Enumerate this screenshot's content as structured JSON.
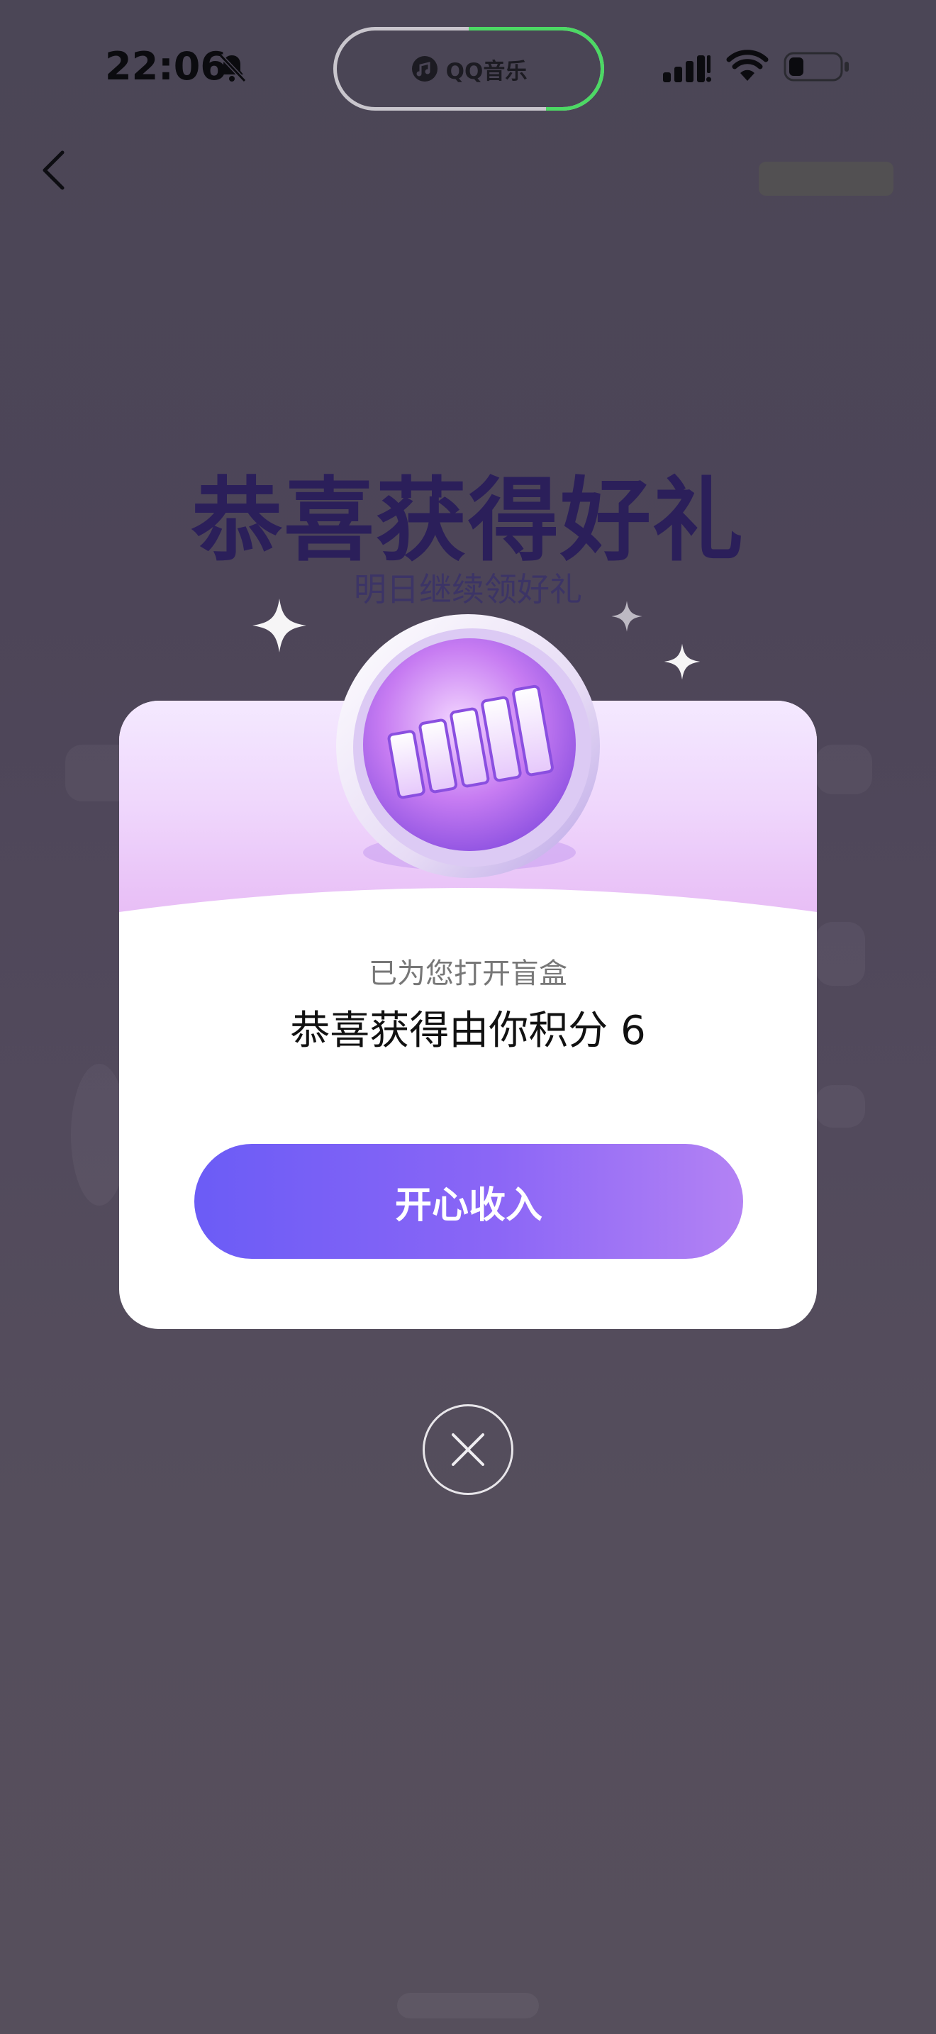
{
  "status_bar": {
    "time": "22:06",
    "island_app": "QQ音乐"
  },
  "background_page": {
    "title": "恭喜获得好礼",
    "subtitle": "明日继续领好礼"
  },
  "modal": {
    "kicker": "已为您打开盲盒",
    "reward_text": "恭喜获得由你积分 6",
    "accept_label": "开心收入"
  },
  "icons": {
    "back": "chevron-left-icon",
    "bell": "bell-slash-icon",
    "signal": "cellular-signal-icon",
    "wifi": "wifi-icon",
    "battery": "battery-icon",
    "coin": "points-coin-icon",
    "close": "close-icon"
  },
  "colors": {
    "overlay": "#4b4656",
    "title_purple": "#2b1f5a",
    "button_start": "#6b5cf6",
    "button_end": "#b382f4",
    "island_progress": "#4cd964"
  }
}
